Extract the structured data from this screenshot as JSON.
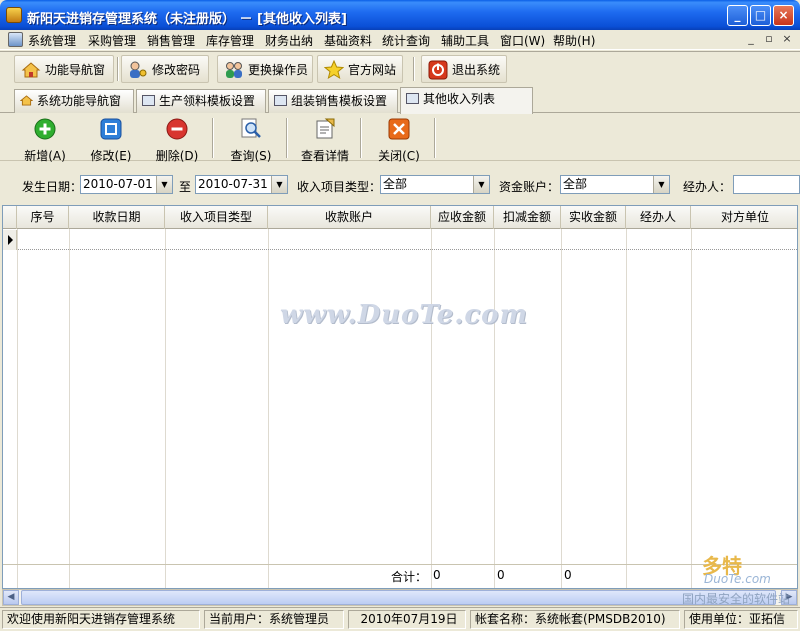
{
  "window": {
    "title": "新阳天进销存管理系统（未注册版） － [其他收入列表]",
    "min_label": "_",
    "max_label": "□",
    "close_label": "×"
  },
  "menu": {
    "items": [
      {
        "label": "系统管理"
      },
      {
        "label": "采购管理"
      },
      {
        "label": "销售管理"
      },
      {
        "label": "库存管理"
      },
      {
        "label": "财务出纳"
      },
      {
        "label": "基础资料"
      },
      {
        "label": "统计查询"
      },
      {
        "label": "辅助工具"
      },
      {
        "label": "窗口(W)"
      },
      {
        "label": "帮助(H)"
      }
    ],
    "mdi_min": "_",
    "mdi_restore": "▫",
    "mdi_close": "×"
  },
  "maintoolbar": {
    "buttons": [
      {
        "label": "功能导航窗",
        "icon": "home-icon"
      },
      {
        "label": "修改密码",
        "icon": "users-key-icon"
      },
      {
        "label": "更换操作员",
        "icon": "users-swap-icon"
      },
      {
        "label": "官方网站",
        "icon": "star-icon"
      },
      {
        "label": "退出系统",
        "icon": "exit-icon"
      }
    ]
  },
  "tabs": [
    {
      "label": "系统功能导航窗",
      "active": false
    },
    {
      "label": "生产领料模板设置",
      "active": false
    },
    {
      "label": "组装销售模板设置",
      "active": false
    },
    {
      "label": "其他收入列表",
      "active": true
    }
  ],
  "formtoolbar": {
    "buttons": [
      {
        "label": "新增(A)",
        "icon": "add-icon",
        "color": "#2fae2f"
      },
      {
        "label": "修改(E)",
        "icon": "edit-icon",
        "color": "#2f7fd8"
      },
      {
        "label": "删除(D)",
        "icon": "delete-icon",
        "color": "#d8352f"
      },
      {
        "label": "查询(S)",
        "icon": "search-icon"
      },
      {
        "label": "查看详情",
        "icon": "details-icon"
      },
      {
        "label": "关闭(C)",
        "icon": "close-icon",
        "color": "#e86a1a"
      }
    ]
  },
  "filter": {
    "date_label": "发生日期：",
    "date_from": "2010-07-01",
    "to_label": "至",
    "date_to": "2010-07-31",
    "type_label": "收入项目类型：",
    "type_value": "全部",
    "account_label": "资金账户：",
    "account_value": "全部",
    "handler_label": "经办人："
  },
  "grid": {
    "columns": [
      "序号",
      "收款日期",
      "收入项目类型",
      "收款账户",
      "应收金额",
      "扣减金额",
      "实收金额",
      "经办人",
      "对方单位"
    ],
    "total_label": "合计：",
    "total_receivable": "0",
    "total_deduct": "0",
    "total_received": "0"
  },
  "watermark": "www.DuoTe.com",
  "corner_logo": {
    "main": "多特",
    "sub": "DuoTe.com",
    "tagline": "国内最安全的软件站"
  },
  "status": {
    "welcome": "欢迎使用新阳天进销存管理系统",
    "user": "当前用户：系统管理员",
    "date": "2010年07月19日",
    "account": "帐套名称：系统帐套(PMSDB2010)",
    "unit": "使用单位：亚拓信"
  }
}
